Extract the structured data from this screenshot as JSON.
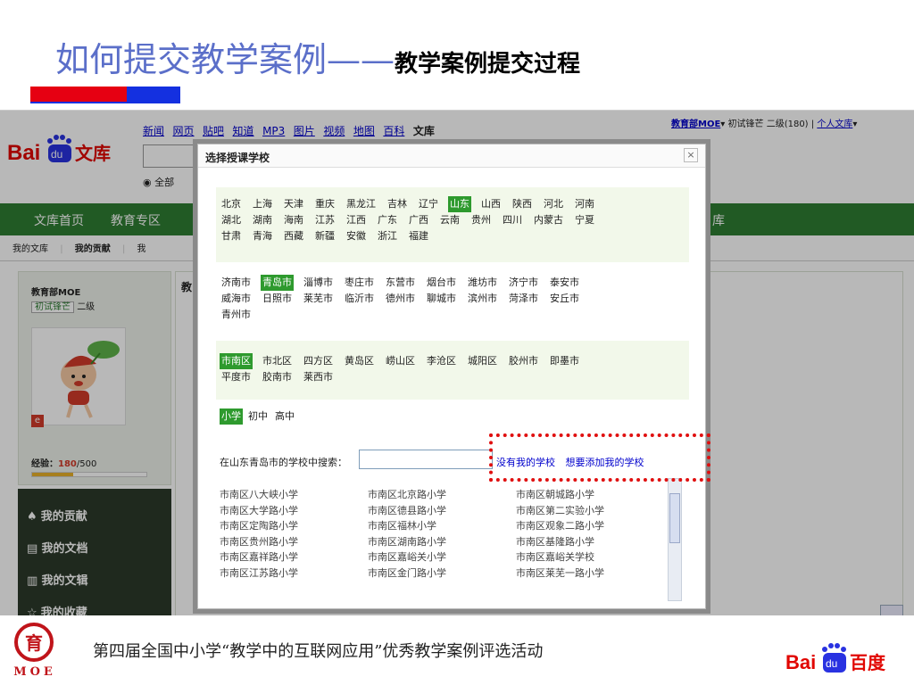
{
  "slide": {
    "title_main": "如何提交教学案例——",
    "title_sub": "教学案例提交过程",
    "footer_text": "第四届全国中小学“教学中的互联网应用”优秀教学案例评选活动",
    "logo_text": "MOE"
  },
  "browser": {
    "nav_links": [
      "新闻",
      "网页",
      "贴吧",
      "知道",
      "MP3",
      "图片",
      "视频",
      "地图",
      "百科"
    ],
    "nav_current": "文库",
    "user_name": "教育部MOE",
    "user_dropdown": "▾",
    "user_level": "初试锋芒 二级(180)",
    "user_lib": "个人文库",
    "search_scope": "全部",
    "tabs": [
      "文库首页",
      "教育专区"
    ],
    "tab_right_fragment": "库",
    "subnav": [
      "我的文库",
      "我的贡献"
    ],
    "subnav_fragment": "我",
    "content_fragment": "教"
  },
  "sidebar": {
    "user": "教育部MOE",
    "level_badge": "初试锋芒",
    "level_text": "二级",
    "exp_label": "经验：",
    "exp_value": "180",
    "exp_total": "/500",
    "exp_progress": 0.36,
    "menu": [
      "我的贡献",
      "我的文档",
      "我的文辑",
      "我的收藏"
    ]
  },
  "modal": {
    "title": "选择授课学校",
    "close": "×",
    "provinces": [
      [
        "北京",
        "上海",
        "天津",
        "重庆",
        "黑龙江",
        "吉林",
        "辽宁",
        "山东",
        "山西",
        "陕西",
        "河北",
        "河南"
      ],
      [
        "湖北",
        "湖南",
        "海南",
        "江苏",
        "江西",
        "广东",
        "广西",
        "云南",
        "贵州",
        "四川",
        "内蒙古",
        "宁夏"
      ],
      [
        "甘肃",
        "青海",
        "西藏",
        "新疆",
        "安徽",
        "浙江",
        "福建"
      ]
    ],
    "province_selected": "山东",
    "cities": [
      [
        "济南市",
        "青岛市",
        "淄博市",
        "枣庄市",
        "东营市",
        "烟台市",
        "潍坊市",
        "济宁市",
        "泰安市"
      ],
      [
        "威海市",
        "日照市",
        "莱芜市",
        "临沂市",
        "德州市",
        "聊城市",
        "滨州市",
        "菏泽市",
        "安丘市"
      ],
      [
        "青州市"
      ]
    ],
    "city_selected": "青岛市",
    "districts": [
      [
        "市南区",
        "市北区",
        "四方区",
        "黄岛区",
        "崂山区",
        "李沧区",
        "城阳区",
        "胶州市",
        "即墨市"
      ],
      [
        "平度市",
        "胶南市",
        "莱西市"
      ]
    ],
    "district_selected": "市南区",
    "levels": [
      "小学",
      "初中",
      "高中"
    ],
    "level_selected": "小学",
    "search_label": "在山东青岛市的学校中搜索：",
    "search_value": "",
    "no_school_link": "没有我的学校",
    "add_school_link": "想要添加我的学校",
    "schools": [
      [
        "市南区八大峡小学",
        "市南区北京路小学",
        "市南区朝城路小学"
      ],
      [
        "市南区大学路小学",
        "市南区德县路小学",
        "市南区第二实验小学"
      ],
      [
        "市南区定陶路小学",
        "市南区福林小学",
        "市南区观象二路小学"
      ],
      [
        "市南区贵州路小学",
        "市南区湖南路小学",
        "市南区基隆路小学"
      ],
      [
        "市南区嘉祥路小学",
        "市南区嘉峪关小学",
        "市南区嘉峪关学校"
      ],
      [
        "市南区江苏路小学",
        "市南区金门路小学",
        "市南区莱芜一路小学"
      ]
    ]
  },
  "colors": {
    "title_blue": "#5b6fc9",
    "selected_green": "#2e9a2e",
    "highlight_red": "#e01010",
    "baidu_blue": "#2932e1",
    "baidu_red": "#e10601"
  }
}
